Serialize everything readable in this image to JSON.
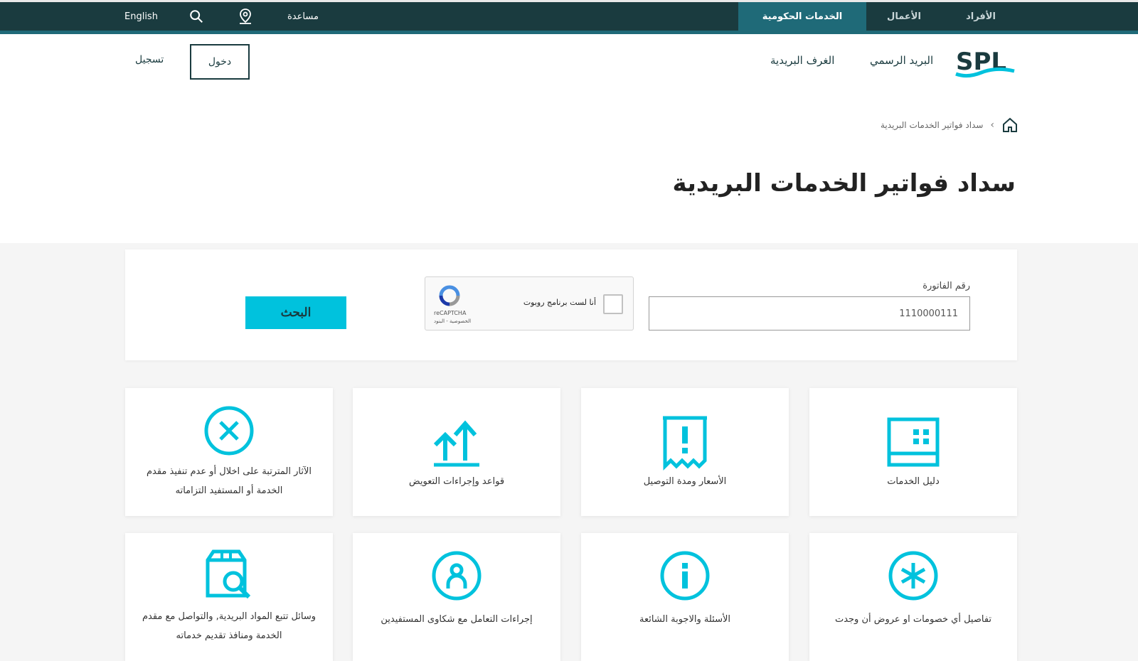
{
  "topbar": {
    "tabs": [
      {
        "label": "الأفراد"
      },
      {
        "label": "الأعمال"
      },
      {
        "label": "الخدمات الحكومية"
      }
    ],
    "help_label": "مساعدة",
    "language_label": "English"
  },
  "header": {
    "logo_text": "SPL",
    "nav": [
      {
        "label": "البريد الرسمي"
      },
      {
        "label": "الغرف البريدية"
      }
    ],
    "login_label": "دخول",
    "register_label": "تسجيل"
  },
  "breadcrumb": {
    "current": "سداد فواتير الخدمات البريدية"
  },
  "page_title": "سداد فواتير الخدمات البريدية",
  "search_form": {
    "invoice_label": "رقم الفاتورة",
    "invoice_value": "1110000111",
    "captcha_label": "أنا لست برنامج روبوت",
    "captcha_brand": "reCAPTCHA",
    "captcha_links": "الخصوصية - البنود",
    "search_button": "البحث"
  },
  "cards": [
    {
      "label": "دليل الخدمات",
      "icon": "grid-panel-icon"
    },
    {
      "label": "الأسعار ومدة التوصيل",
      "icon": "receipt-alert-icon"
    },
    {
      "label": "قواعد وإجراءات التعويض",
      "icon": "double-arrow-up-icon"
    },
    {
      "label": "الآثار المترتبة على اخلال أو عدم تنفيذ مقدم الخدمة أو المستفيد التزاماته",
      "icon": "close-circle-icon"
    },
    {
      "label": "تفاصيل أي خصومات او عروض أن وجدت",
      "icon": "asterisk-circle-icon"
    },
    {
      "label": "الأسئلة والاجوبة الشائعة",
      "icon": "info-circle-icon"
    },
    {
      "label": "إجراءات التعامل مع شكاوى المستفيدين",
      "icon": "user-circle-icon"
    },
    {
      "label": "وسائل تتبع المواد البريدية, والتواصل مع مقدم الخدمة ومنافذ تقديم خدماته",
      "icon": "box-search-icon"
    }
  ],
  "colors": {
    "topbar": "#1a3b3f",
    "topbar_active": "#1f6a78",
    "accent": "#00c2dd"
  }
}
